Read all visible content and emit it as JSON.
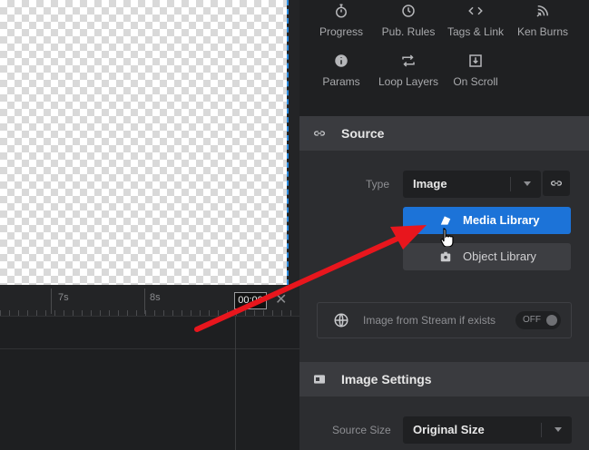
{
  "timeline": {
    "tick_7s": "7s",
    "tick_8s": "8s",
    "time_value": "00:00",
    "close_symbol": "✕"
  },
  "toolbar": {
    "items": [
      {
        "label": "Progress",
        "icon": "stopwatch-icon"
      },
      {
        "label": "Pub. Rules",
        "icon": "clock-icon"
      },
      {
        "label": "Tags & Link",
        "icon": "code-icon"
      },
      {
        "label": "Ken Burns",
        "icon": "ken-burns-icon"
      },
      {
        "label": "Params",
        "icon": "info-icon"
      },
      {
        "label": "Loop Layers",
        "icon": "loop-icon"
      },
      {
        "label": "On Scroll",
        "icon": "scroll-icon"
      }
    ]
  },
  "source": {
    "title": "Source",
    "type_label": "Type",
    "type_value": "Image",
    "media_library": "Media Library",
    "object_library": "Object Library",
    "stream_label": "Image from Stream if exists",
    "stream_toggle": "OFF"
  },
  "image_settings": {
    "title": "Image Settings",
    "source_size_label": "Source Size",
    "source_size_value": "Original Size"
  },
  "colors": {
    "accent": "#1c73d8",
    "annotation_arrow": "#e8161d",
    "guide": "#2d8cdf"
  }
}
